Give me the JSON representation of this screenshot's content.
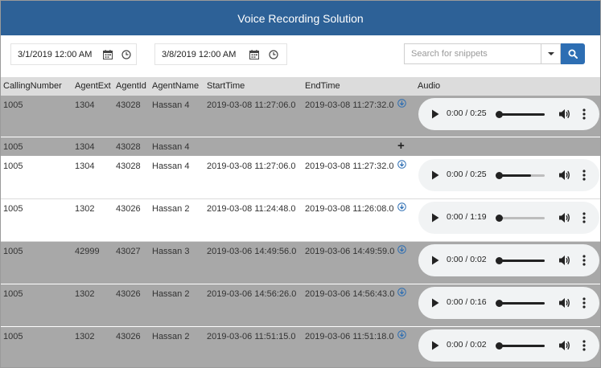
{
  "header": {
    "title": "Voice Recording Solution"
  },
  "filters": {
    "start_date": "3/1/2019 12:00 AM",
    "end_date": "3/8/2019 12:00 AM",
    "search_placeholder": "Search for snippets"
  },
  "columns": [
    "CallingNumber",
    "AgentExt",
    "AgentId",
    "AgentName",
    "StartTime",
    "EndTime",
    "Audio"
  ],
  "rows": [
    {
      "calling": "1005",
      "ext": "1304",
      "agent_id": "43028",
      "agent_name": "Hassan 4",
      "start": "2019-03-08 11:27:06.0",
      "end": "2019-03-08 11:27:32.0",
      "audio_time": "0:00 / 0:25",
      "volume_level": 1.0,
      "style": "gray",
      "kind": "audio"
    },
    {
      "calling": "1005",
      "ext": "1304",
      "agent_id": "43028",
      "agent_name": "Hassan 4",
      "start": "",
      "end": "",
      "audio_time": "",
      "style": "gray",
      "kind": "group"
    },
    {
      "calling": "1005",
      "ext": "1304",
      "agent_id": "43028",
      "agent_name": "Hassan 4",
      "start": "2019-03-08 11:27:06.0",
      "end": "2019-03-08 11:27:32.0",
      "audio_time": "0:00 / 0:25",
      "volume_level": 0.7,
      "style": "white",
      "kind": "audio"
    },
    {
      "calling": "1005",
      "ext": "1302",
      "agent_id": "43026",
      "agent_name": "Hassan 2",
      "start": "2019-03-08 11:24:48.0",
      "end": "2019-03-08 11:26:08.0",
      "audio_time": "0:00 / 1:19",
      "volume_level": 0.0,
      "style": "white",
      "kind": "audio"
    },
    {
      "calling": "1005",
      "ext": "42999",
      "agent_id": "43027",
      "agent_name": "Hassan 3",
      "start": "2019-03-06 14:49:56.0",
      "end": "2019-03-06 14:49:59.0",
      "audio_time": "0:00 / 0:02",
      "volume_level": 1.0,
      "style": "gray",
      "kind": "audio"
    },
    {
      "calling": "1005",
      "ext": "1302",
      "agent_id": "43026",
      "agent_name": "Hassan 2",
      "start": "2019-03-06 14:56:26.0",
      "end": "2019-03-06 14:56:43.0",
      "audio_time": "0:00 / 0:16",
      "volume_level": 1.0,
      "style": "gray",
      "kind": "audio"
    },
    {
      "calling": "1005",
      "ext": "1302",
      "agent_id": "43026",
      "agent_name": "Hassan 2",
      "start": "2019-03-06 11:51:15.0",
      "end": "2019-03-06 11:51:18.0",
      "audio_time": "0:00 / 0:02",
      "volume_level": 1.0,
      "style": "gray",
      "kind": "audio"
    }
  ],
  "colors": {
    "header_bg": "#2d6197",
    "row_gray": "#a8a8a8",
    "accent": "#2d6eb3"
  }
}
